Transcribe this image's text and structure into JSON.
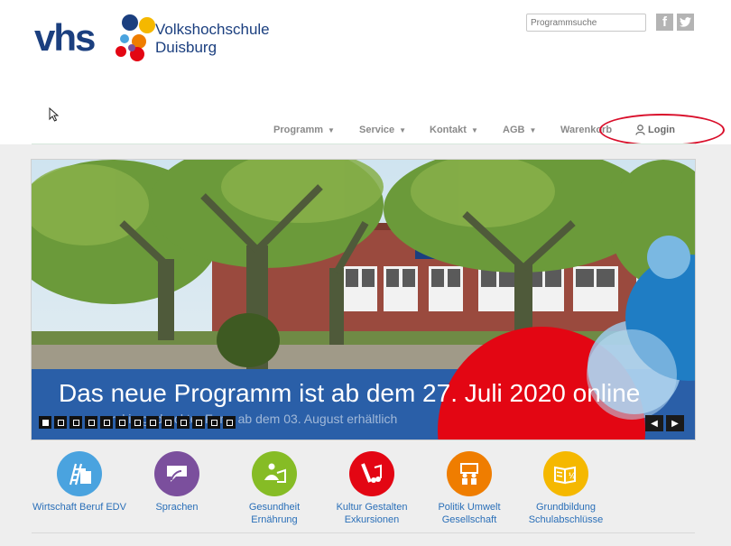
{
  "header": {
    "logo_short": "vhs",
    "logo_line1": "Volkshochschule",
    "logo_line2": "Duisburg",
    "search_placeholder": "Programmsuche",
    "social": [
      "facebook-icon",
      "twitter-icon"
    ]
  },
  "nav": {
    "items": [
      {
        "label": "Programm",
        "has_dropdown": true
      },
      {
        "label": "Service",
        "has_dropdown": true
      },
      {
        "label": "Kontakt",
        "has_dropdown": true
      },
      {
        "label": "AGB",
        "has_dropdown": true
      },
      {
        "label": "Warenkorb",
        "has_dropdown": false
      }
    ],
    "login_label": "Login",
    "login_icon": "user-icon"
  },
  "slider": {
    "headline": "Das neue Programm ist ab dem 27. Juli 2020 online",
    "subline": "und in gedruckter Form ab dem 03. August erhältlich",
    "slide_count": 13,
    "active_slide": 1,
    "prev_icon": "triangle-left-icon",
    "next_icon": "triangle-right-icon"
  },
  "categories": [
    {
      "line1": "Wirtschaft Beruf EDV",
      "line2": "",
      "color": "#4aa3df",
      "icon": "ladder-folder-icon"
    },
    {
      "line1": "Sprachen",
      "line2": "",
      "color": "#7b4f9d",
      "icon": "speech-bubble-icon"
    },
    {
      "line1": "Gesundheit",
      "line2": "Ernährung",
      "color": "#86bc25",
      "icon": "yoga-icon"
    },
    {
      "line1": "Kultur Gestalten",
      "line2": "Exkursionen",
      "color": "#e30613",
      "icon": "brush-music-icon"
    },
    {
      "line1": "Politik Umwelt",
      "line2": "Gesellschaft",
      "color": "#ef7d00",
      "icon": "people-board-icon"
    },
    {
      "line1": "Grundbildung",
      "line2": "Schulabschlüsse",
      "color": "#f5b800",
      "icon": "book-half-icon"
    }
  ],
  "colors": {
    "brand_blue": "#1b3f7f",
    "nav_text": "#8a8a8a",
    "link_blue": "#2a6fb8",
    "annotation_red": "#d90e2a"
  }
}
